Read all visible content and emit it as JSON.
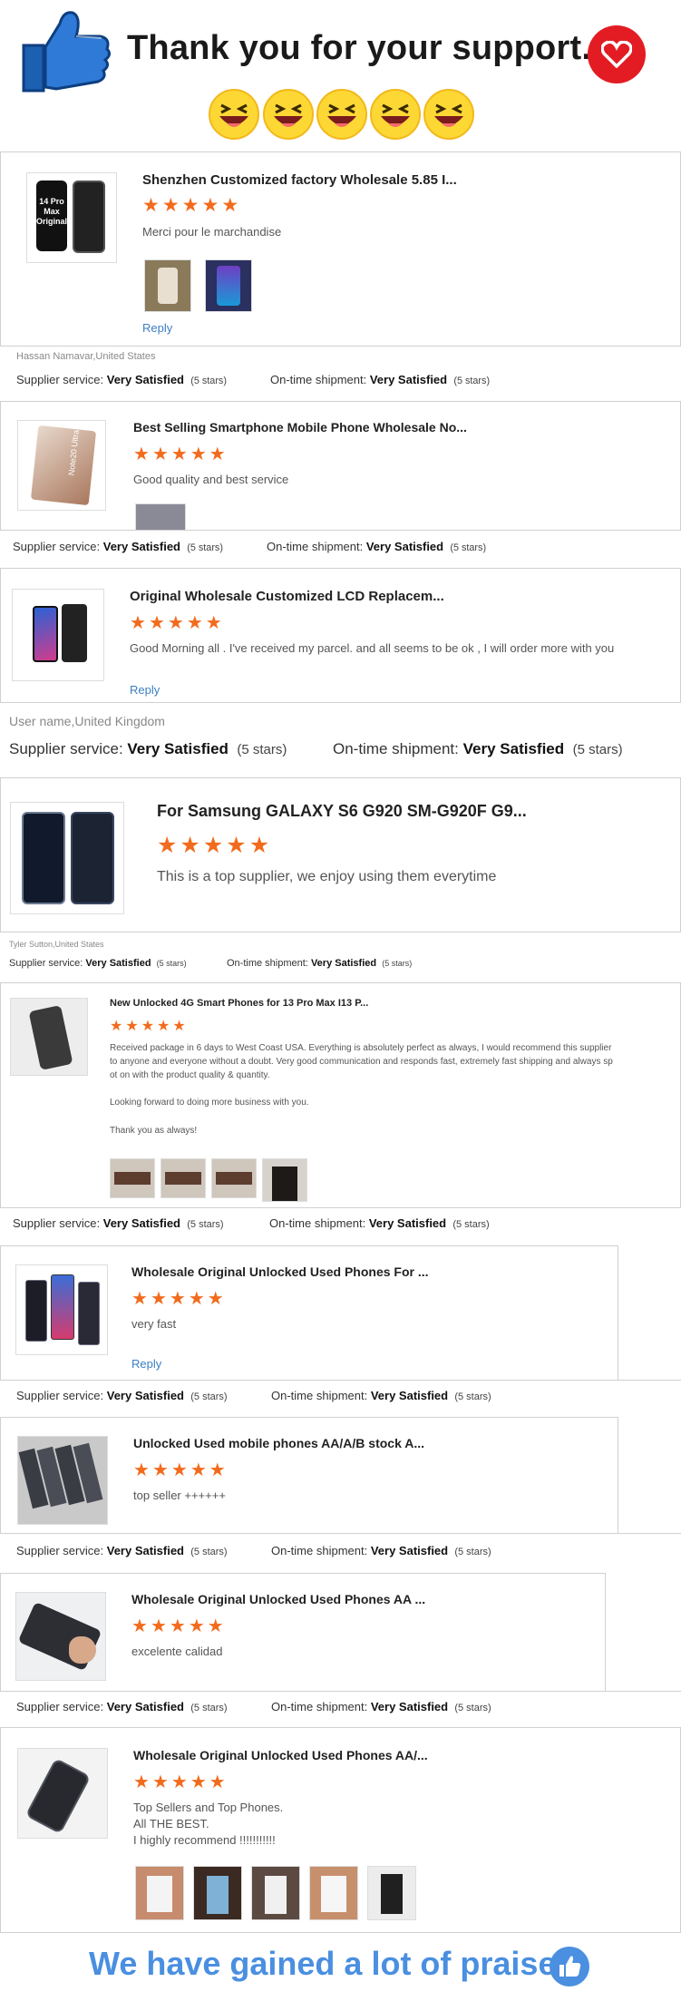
{
  "header": {
    "title": "Thank you for your support."
  },
  "footer": {
    "text": "We have gained a lot of praise."
  },
  "reply_label": "Reply",
  "reviews": [
    {
      "title": "Shenzhen Customized factory Wholesale 5.85 I...",
      "text": "Merci pour le marchandise",
      "product_label": "14 Pro Max Original",
      "user": "Hassan Namavar,United States",
      "supplier_label": "Supplier service:",
      "supplier_value": "Very Satisfied",
      "supplier_stars": "(5 stars)",
      "ship_label": "On-time shipment:",
      "ship_value": "Very Satisfied",
      "ship_stars": "(5 stars)"
    },
    {
      "title": "Best Selling Smartphone Mobile Phone Wholesale No...",
      "text": "Good quality and best service",
      "product_label": "Note20 Ultra",
      "supplier_label": "Supplier service:",
      "supplier_value": "Very Satisfied",
      "supplier_stars": "(5 stars)",
      "ship_label": "On-time shipment:",
      "ship_value": "Very Satisfied",
      "ship_stars": "(5 stars)"
    },
    {
      "title": "Original Wholesale Customized LCD Replacem...",
      "text": "Good Morning all . I've received my parcel. and all seems to be ok , I will order more with you",
      "user": "User name,United Kingdom",
      "supplier_label": "Supplier service:",
      "supplier_value": "Very Satisfied",
      "supplier_stars": "(5 stars)",
      "ship_label": "On-time shipment:",
      "ship_value": "Very Satisfied",
      "ship_stars": "(5 stars)"
    },
    {
      "title": "For Samsung GALAXY S6 G920 SM-G920F G9...",
      "text": "This is a top supplier, we enjoy using them everytime",
      "user": "Tyler Sutton,United States",
      "supplier_label": "Supplier service:",
      "supplier_value": "Very Satisfied",
      "supplier_stars": "(5 stars)",
      "ship_label": "On-time shipment:",
      "ship_value": "Very Satisfied",
      "ship_stars": "(5 stars)"
    },
    {
      "title": "New Unlocked 4G Smart Phones for 13 Pro Max I13 P...",
      "text": "Received package in 6 days to West Coast USA. Everything is absolutely perfect as always, I would recommend this supplier to anyone and everyone without a doubt. Very good communication and responds fast, extremely fast shipping and always spot on with the product quality & quantity.",
      "text2": "Looking forward to doing more business with you.",
      "text3": "Thank you as always!",
      "supplier_label": "Supplier service:",
      "supplier_value": "Very Satisfied",
      "supplier_stars": "(5 stars)",
      "ship_label": "On-time shipment:",
      "ship_value": "Very Satisfied",
      "ship_stars": "(5 stars)"
    },
    {
      "title": "Wholesale Original Unlocked Used Phones For ...",
      "text": "very fast",
      "supplier_label": "Supplier service:",
      "supplier_value": "Very Satisfied",
      "supplier_stars": "(5 stars)",
      "ship_label": "On-time shipment:",
      "ship_value": "Very Satisfied",
      "ship_stars": "(5 stars)"
    },
    {
      "title": "Unlocked Used mobile phones AA/A/B stock A...",
      "text": "top seller ++++++",
      "supplier_label": "Supplier service:",
      "supplier_value": "Very Satisfied",
      "supplier_stars": "(5 stars)",
      "ship_label": "On-time shipment:",
      "ship_value": "Very Satisfied",
      "ship_stars": "(5 stars)"
    },
    {
      "title": "Wholesale Original Unlocked Used Phones AA ...",
      "text": "excelente calidad",
      "supplier_label": "Supplier service:",
      "supplier_value": "Very Satisfied",
      "supplier_stars": "(5 stars)",
      "ship_label": "On-time shipment:",
      "ship_value": "Very Satisfied",
      "ship_stars": "(5 stars)"
    },
    {
      "title": "Wholesale Original Unlocked Used Phones AA/...",
      "text": "Top Sellers and Top Phones.",
      "text2": "All THE BEST.",
      "text3": "I highly recommend !!!!!!!!!!!"
    }
  ],
  "rating": {
    "stars": 5,
    "max": 5
  },
  "colors": {
    "star": "#f26b1d",
    "link": "#3b7fc4",
    "footer": "#4a8fe0",
    "heart": "#e31c23"
  },
  "icons": [
    "thumbs-up-icon",
    "heart-icon",
    "laughing-emoji-icon",
    "star-icon",
    "thumbs-up-icon"
  ]
}
